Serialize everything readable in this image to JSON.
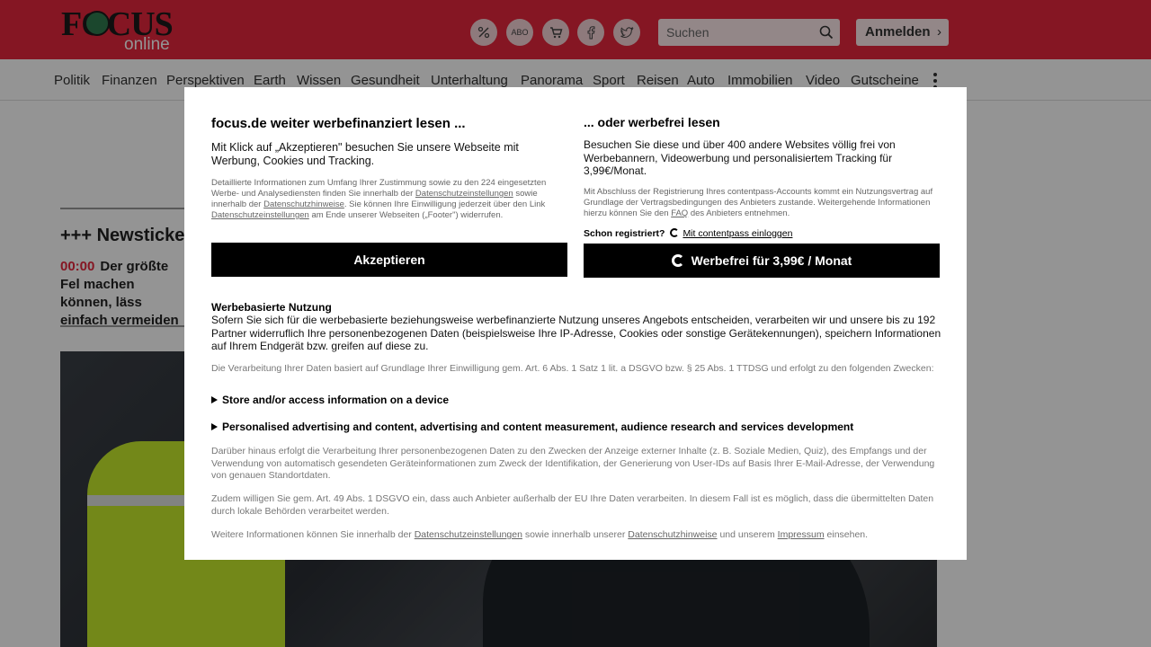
{
  "header": {
    "logo_text": "FOCUS",
    "logo_sub": "online",
    "icons": [
      "percent-icon",
      "abo-icon",
      "cart-icon",
      "facebook-icon",
      "twitter-icon"
    ],
    "abo_label": "ABO",
    "search_placeholder": "Suchen",
    "login_label": "Anmelden",
    "login_chevron": "›"
  },
  "nav": {
    "items": [
      "Politik",
      "Finanzen",
      "Perspektiven",
      "Earth",
      "Wissen",
      "Gesundheit",
      "Unterhaltung",
      "Panorama",
      "Sport",
      "Reisen",
      "Auto",
      "Immobilien",
      "Video",
      "Gutscheine"
    ]
  },
  "content": {
    "ticker_title": "+++ Newsticker",
    "ticker_time": "00:00",
    "ticker_text": "Der größte Fel machen können, läss einfach vermeiden"
  },
  "consent": {
    "left_heading": "focus.de weiter werbefinanziert lesen ...",
    "left_intro": "Mit Klick auf „Akzeptieren\" besuchen Sie unsere Webseite mit Werbung, Cookies und Tracking.",
    "left_detail_1": "Detaillierte Informationen zum Umfang Ihrer Zustimmung sowie zu den 224 eingesetzten Werbe- und Analysediensten finden Sie innerhalb der",
    "left_detail_link1": "Datenschutzeinstellungen",
    "left_detail_2": "sowie innerhalb der",
    "left_detail_link2": "Datenschutzhinweise",
    "left_detail_3": ". Sie können Ihre Einwilligung jederzeit über den Link",
    "left_detail_link3": "Datenschutzeinstellungen",
    "left_detail_4": "am Ende unserer Webseiten („Footer\") widerrufen.",
    "accept_label": "Akzeptieren",
    "right_heading": "... oder werbefrei lesen",
    "right_intro": "Besuchen Sie diese und über 400 andere Websites völlig frei von Werbebannern, Videowerbung und personalisiertem Tracking für 3,99€/Monat.",
    "right_detail_1": "Mit Abschluss der Registrierung Ihres contentpass-Accounts kommt ein Nutzungsvertrag auf Grundlage der Vertragsbedingungen des Anbieters zustande. Weitergehende Informationen hierzu können Sie den",
    "right_detail_link": "FAQ",
    "right_detail_2": "des Anbieters entnehmen.",
    "registered_label": "Schon registriert?",
    "contentpass_login": "Mit contentpass einloggen",
    "adfree_label": "Werbefrei für 3,99€ / Monat",
    "section_title": "Werbebasierte Nutzung",
    "section_text": "Sofern Sie sich für die werbebasierte beziehungsweise werbefinanzierte Nutzung unseres Angebots entscheiden, verarbeiten wir und unsere bis zu 192 Partner widerruflich Ihre personenbezogenen Daten (beispielsweise Ihre IP-Adresse, Cookies oder sonstige Gerätekennungen), speichern Informationen auf Ihrem Endgerät bzw. greifen auf diese zu.",
    "legal_basis": "Die Verarbeitung Ihrer Daten basiert auf Grundlage Ihrer Einwilligung gem. Art. 6 Abs. 1 Satz 1 lit. a DSGVO bzw. § 25 Abs. 1 TTDSG und erfolgt zu den folgenden Zwecken:",
    "purposes": [
      "Store and/or access information on a device",
      "Personalised advertising and content, advertising and content measurement, audience research and services development"
    ],
    "further_processing": "Darüber hinaus erfolgt die Verarbeitung Ihrer personenbezogenen Daten zu den Zwecken der Anzeige externer Inhalte (z. B. Soziale Medien, Quiz), des Empfangs und der Verwendung von automatisch gesendeten Geräteinformationen zum Zweck der Identifikation, der Generierung von User-IDs auf Basis Ihrer E-Mail-Adresse, der Verwendung von genauen Standortdaten.",
    "third_country": "Zudem willigen Sie gem. Art. 49 Abs. 1 DSGVO ein, dass auch Anbieter außerhalb der EU Ihre Daten verarbeiten. In diesem Fall ist es möglich, dass die übermittelten Daten durch lokale Behörden verarbeitet werden.",
    "footer_1": "Weitere Informationen können Sie innerhalb der",
    "footer_link1": "Datenschutzeinstellungen",
    "footer_2": "sowie innerhalb unserer",
    "footer_link2": "Datenschutzhinweise",
    "footer_3": "und unserem",
    "footer_link3": "Impressum",
    "footer_4": "einsehen."
  },
  "colors": {
    "brand_red": "#e5273d",
    "button_black": "#000000"
  }
}
